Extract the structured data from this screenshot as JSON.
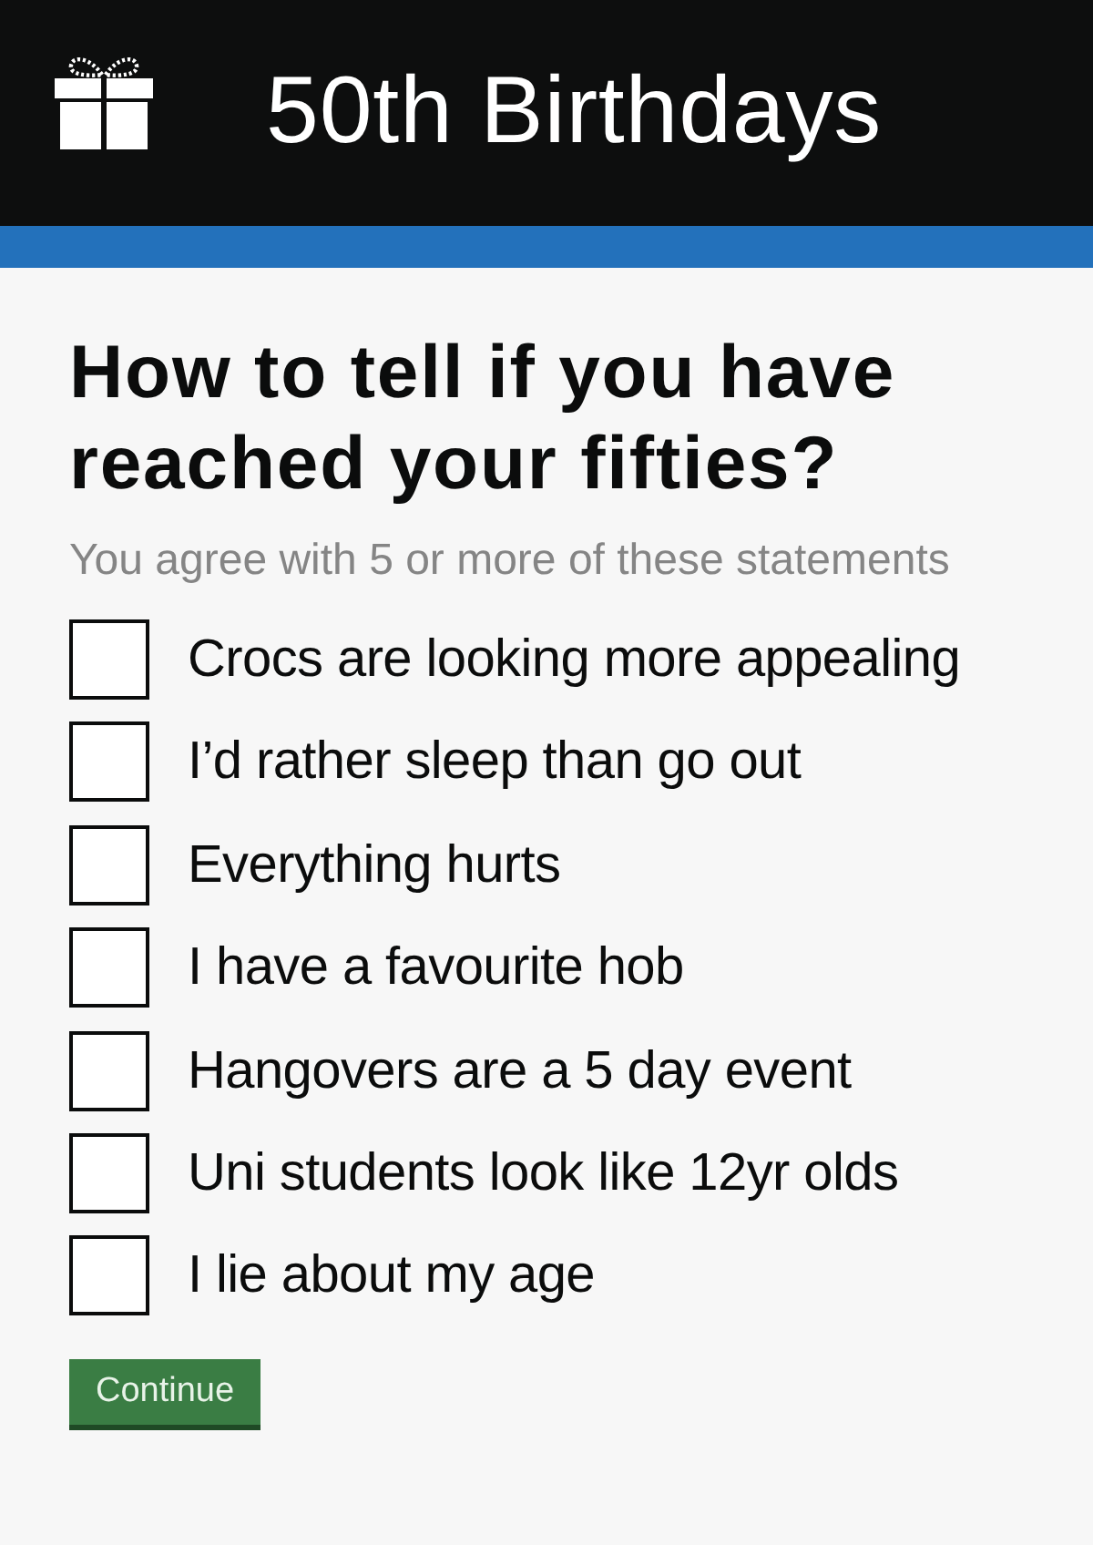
{
  "header": {
    "title": "50th Birthdays"
  },
  "question": {
    "heading": "How to tell if you have reached your fifties?",
    "hint": "You agree with 5 or more of these statements"
  },
  "options": [
    {
      "label": "Crocs are looking more appealing",
      "checked": false
    },
    {
      "label": "I’d rather sleep than go out",
      "checked": false
    },
    {
      "label": "Everything hurts",
      "checked": false
    },
    {
      "label": "I have a favourite hob",
      "checked": false
    },
    {
      "label": "Hangovers are a 5 day event",
      "checked": false
    },
    {
      "label": "Uni students look like 12yr olds",
      "checked": false
    },
    {
      "label": "I lie about my age",
      "checked": false
    }
  ],
  "button": {
    "label": "Continue"
  }
}
